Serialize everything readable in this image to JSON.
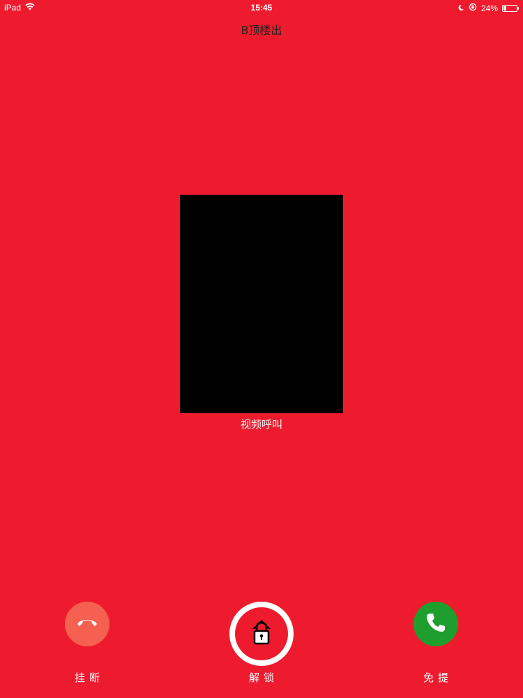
{
  "status_bar": {
    "device": "iPad",
    "time": "15:45",
    "battery": "24%",
    "battery_level": 0.24
  },
  "call": {
    "title": "B顶楼出",
    "video_caption": "视频呼叫"
  },
  "actions": {
    "hangup": {
      "label": "挂断",
      "icon": "phone-hangup-icon",
      "color": "#f56050"
    },
    "unlock": {
      "label": "解锁",
      "icon": "lock-icon",
      "color": "#ffffff"
    },
    "handsfree": {
      "label": "免提",
      "icon": "phone-icon",
      "color": "#1e9e2c"
    }
  },
  "colors": {
    "background": "#ee1b2e",
    "video": "#000000"
  }
}
